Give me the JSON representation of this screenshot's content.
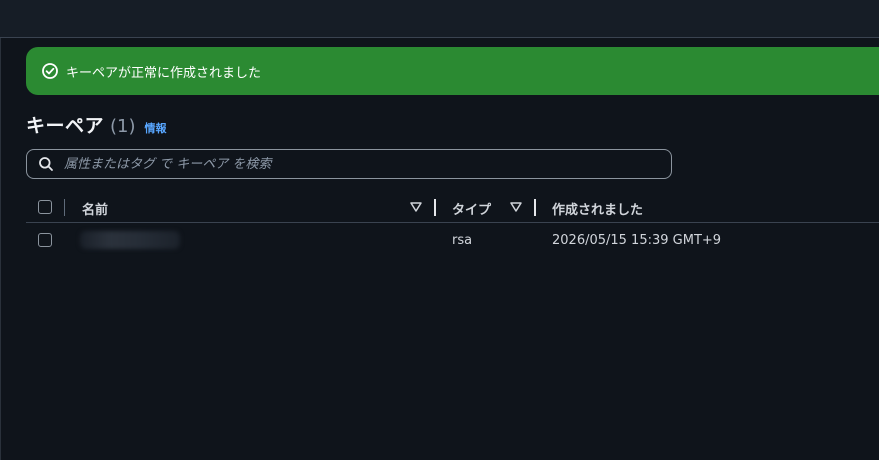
{
  "flash": {
    "message": "キーペアが正常に作成されました",
    "icon": "success-check-icon",
    "color": "#2b8a32"
  },
  "header": {
    "title": "キーペア",
    "count": "(1)",
    "info_link": "情報"
  },
  "search": {
    "placeholder": "属性またはタグ で キーペア を検索",
    "value": ""
  },
  "table": {
    "columns": [
      "名前",
      "タイプ",
      "作成されました"
    ],
    "rows": [
      {
        "name": "",
        "type": "rsa",
        "created": "2026/05/15 15:39 GMT+9"
      }
    ]
  },
  "colors": {
    "accent_link": "#58a6ff",
    "background": "#0f141b",
    "success": "#2b8a32"
  }
}
